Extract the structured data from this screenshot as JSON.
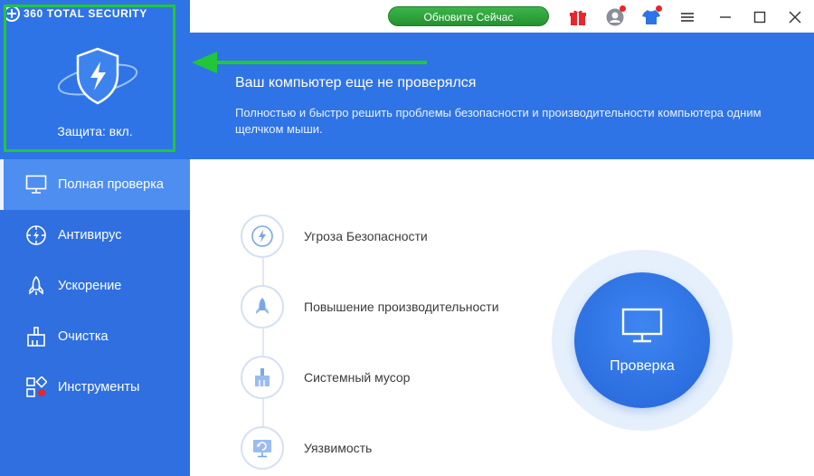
{
  "app": {
    "brand": "360 TOTAL SECURITY",
    "protection_status": "Защита: вкл."
  },
  "topbar": {
    "update_button": "Обновите Сейчас",
    "icons": [
      "gift-icon",
      "user-icon",
      "tshirt-icon",
      "menu-icon",
      "minimize-icon",
      "maximize-icon",
      "close-icon"
    ]
  },
  "banner": {
    "title": "Ваш компьютер еще не проверялся",
    "description": "Полностью и быстро решить проблемы безопасности и производительности компьютера одним щелчком мыши."
  },
  "sidebar": {
    "items": [
      {
        "label": "Полная проверка",
        "icon": "monitor-icon",
        "active": true
      },
      {
        "label": "Антивирус",
        "icon": "antivirus-icon",
        "active": false
      },
      {
        "label": "Ускорение",
        "icon": "rocket-icon",
        "active": false
      },
      {
        "label": "Очистка",
        "icon": "broom-icon",
        "active": false
      },
      {
        "label": "Инструменты",
        "icon": "tools-icon",
        "active": false
      }
    ]
  },
  "main": {
    "features": [
      {
        "label": "Угроза Безопасности",
        "icon": "security-threat-icon"
      },
      {
        "label": "Повышение производительности",
        "icon": "rocket-icon"
      },
      {
        "label": "Системный мусор",
        "icon": "broom-icon"
      },
      {
        "label": "Уязвимость",
        "icon": "vulnerability-icon"
      }
    ],
    "scan_button": "Проверка"
  },
  "colors": {
    "sidebar": "#2f6fe0",
    "banner": "#2f74e6",
    "active_nav": "#4d8ef0",
    "update_button": "#2ea53b",
    "highlight": "#21c739",
    "notification_dot": "#e8262b"
  }
}
